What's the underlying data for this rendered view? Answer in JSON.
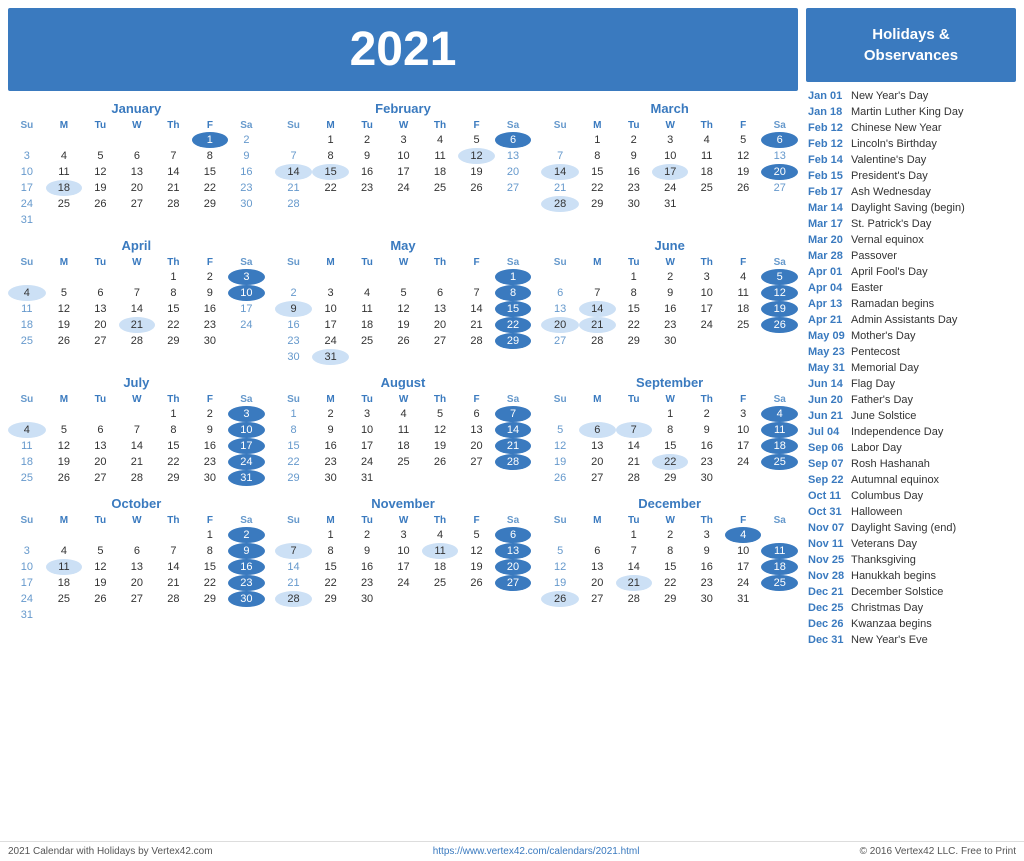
{
  "header": {
    "year": "2021",
    "sidebar_title": "Holidays &\nObservances"
  },
  "months": [
    {
      "name": "January",
      "days_of_week": [
        "Su",
        "M",
        "Tu",
        "W",
        "Th",
        "F",
        "Sa"
      ],
      "weeks": [
        [
          "",
          "",
          "",
          "",
          "",
          "1",
          "2"
        ],
        [
          "3",
          "4",
          "5",
          "6",
          "7",
          "8",
          "9"
        ],
        [
          "10",
          "11",
          "12",
          "13",
          "14",
          "15",
          "16"
        ],
        [
          "17",
          "18",
          "19",
          "20",
          "21",
          "22",
          "23"
        ],
        [
          "24",
          "25",
          "26",
          "27",
          "28",
          "29",
          "30"
        ],
        [
          "31",
          "",
          "",
          "",
          "",
          "",
          ""
        ]
      ],
      "highlights": [
        "1"
      ],
      "light_highlights": [
        "18"
      ]
    },
    {
      "name": "February",
      "days_of_week": [
        "Su",
        "M",
        "Tu",
        "W",
        "Th",
        "F",
        "Sa"
      ],
      "weeks": [
        [
          "",
          "1",
          "2",
          "3",
          "4",
          "5",
          "6"
        ],
        [
          "7",
          "8",
          "9",
          "10",
          "11",
          "12",
          "13"
        ],
        [
          "14",
          "15",
          "16",
          "17",
          "18",
          "19",
          "20"
        ],
        [
          "21",
          "22",
          "23",
          "24",
          "25",
          "26",
          "27"
        ],
        [
          "28",
          "",
          "",
          "",
          "",
          "",
          ""
        ]
      ],
      "highlights": [
        "6"
      ],
      "light_highlights": [
        "14",
        "15",
        "12"
      ]
    },
    {
      "name": "March",
      "days_of_week": [
        "Su",
        "M",
        "Tu",
        "W",
        "Th",
        "F",
        "Sa"
      ],
      "weeks": [
        [
          "",
          "1",
          "2",
          "3",
          "4",
          "5",
          "6"
        ],
        [
          "7",
          "8",
          "9",
          "10",
          "11",
          "12",
          "13"
        ],
        [
          "14",
          "15",
          "16",
          "17",
          "18",
          "19",
          "20"
        ],
        [
          "21",
          "22",
          "23",
          "24",
          "25",
          "26",
          "27"
        ],
        [
          "28",
          "29",
          "30",
          "31",
          "",
          "",
          ""
        ]
      ],
      "highlights": [
        "6",
        "20"
      ],
      "light_highlights": [
        "14",
        "17",
        "28"
      ]
    },
    {
      "name": "April",
      "days_of_week": [
        "Su",
        "M",
        "Tu",
        "W",
        "Th",
        "F",
        "Sa"
      ],
      "weeks": [
        [
          "",
          "",
          "",
          "",
          "1",
          "2",
          "3"
        ],
        [
          "4",
          "5",
          "6",
          "7",
          "8",
          "9",
          "10"
        ],
        [
          "11",
          "12",
          "13",
          "14",
          "15",
          "16",
          "17"
        ],
        [
          "18",
          "19",
          "20",
          "21",
          "22",
          "23",
          "24"
        ],
        [
          "25",
          "26",
          "27",
          "28",
          "29",
          "30",
          ""
        ]
      ],
      "highlights": [
        "3",
        "10"
      ],
      "light_highlights": [
        "4",
        "21"
      ]
    },
    {
      "name": "May",
      "days_of_week": [
        "Su",
        "M",
        "Tu",
        "W",
        "Th",
        "F",
        "Sa"
      ],
      "weeks": [
        [
          "",
          "",
          "",
          "",
          "",
          "",
          "1"
        ],
        [
          "2",
          "3",
          "4",
          "5",
          "6",
          "7",
          "8"
        ],
        [
          "9",
          "10",
          "11",
          "12",
          "13",
          "14",
          "15"
        ],
        [
          "16",
          "17",
          "18",
          "19",
          "20",
          "21",
          "22"
        ],
        [
          "23",
          "24",
          "25",
          "26",
          "27",
          "28",
          "29"
        ],
        [
          "30",
          "31",
          "",
          "",
          "",
          "",
          ""
        ]
      ],
      "highlights": [
        "1",
        "8",
        "15",
        "22",
        "29"
      ],
      "light_highlights": [
        "9",
        "31"
      ]
    },
    {
      "name": "June",
      "days_of_week": [
        "Su",
        "M",
        "Tu",
        "W",
        "Th",
        "F",
        "Sa"
      ],
      "weeks": [
        [
          "",
          "",
          "1",
          "2",
          "3",
          "4",
          "5"
        ],
        [
          "6",
          "7",
          "8",
          "9",
          "10",
          "11",
          "12"
        ],
        [
          "13",
          "14",
          "15",
          "16",
          "17",
          "18",
          "19"
        ],
        [
          "20",
          "21",
          "22",
          "23",
          "24",
          "25",
          "26"
        ],
        [
          "27",
          "28",
          "29",
          "30",
          "",
          "",
          ""
        ]
      ],
      "highlights": [
        "5",
        "12",
        "19",
        "26"
      ],
      "light_highlights": [
        "14",
        "20",
        "21"
      ]
    },
    {
      "name": "July",
      "days_of_week": [
        "Su",
        "M",
        "Tu",
        "W",
        "Th",
        "F",
        "Sa"
      ],
      "weeks": [
        [
          "",
          "",
          "",
          "",
          "1",
          "2",
          "3"
        ],
        [
          "4",
          "5",
          "6",
          "7",
          "8",
          "9",
          "10"
        ],
        [
          "11",
          "12",
          "13",
          "14",
          "15",
          "16",
          "17"
        ],
        [
          "18",
          "19",
          "20",
          "21",
          "22",
          "23",
          "24"
        ],
        [
          "25",
          "26",
          "27",
          "28",
          "29",
          "30",
          "31"
        ]
      ],
      "highlights": [
        "3",
        "10",
        "17",
        "24",
        "31"
      ],
      "light_highlights": [
        "4"
      ]
    },
    {
      "name": "August",
      "days_of_week": [
        "Su",
        "M",
        "Tu",
        "W",
        "Th",
        "F",
        "Sa"
      ],
      "weeks": [
        [
          "1",
          "2",
          "3",
          "4",
          "5",
          "6",
          "7"
        ],
        [
          "8",
          "9",
          "10",
          "11",
          "12",
          "13",
          "14"
        ],
        [
          "15",
          "16",
          "17",
          "18",
          "19",
          "20",
          "21"
        ],
        [
          "22",
          "23",
          "24",
          "25",
          "26",
          "27",
          "28"
        ],
        [
          "29",
          "30",
          "31",
          "",
          "",
          "",
          ""
        ]
      ],
      "highlights": [
        "7",
        "14",
        "21",
        "28"
      ],
      "light_highlights": []
    },
    {
      "name": "September",
      "days_of_week": [
        "Su",
        "M",
        "Tu",
        "W",
        "Th",
        "F",
        "Sa"
      ],
      "weeks": [
        [
          "",
          "",
          "",
          "1",
          "2",
          "3",
          "4"
        ],
        [
          "5",
          "6",
          "7",
          "8",
          "9",
          "10",
          "11"
        ],
        [
          "12",
          "13",
          "14",
          "15",
          "16",
          "17",
          "18"
        ],
        [
          "19",
          "20",
          "21",
          "22",
          "23",
          "24",
          "25"
        ],
        [
          "26",
          "27",
          "28",
          "29",
          "30",
          "",
          ""
        ]
      ],
      "highlights": [
        "4",
        "11",
        "18",
        "25"
      ],
      "light_highlights": [
        "6",
        "7",
        "22"
      ]
    },
    {
      "name": "October",
      "days_of_week": [
        "Su",
        "M",
        "Tu",
        "W",
        "Th",
        "F",
        "Sa"
      ],
      "weeks": [
        [
          "",
          "",
          "",
          "",
          "",
          "1",
          "2"
        ],
        [
          "3",
          "4",
          "5",
          "6",
          "7",
          "8",
          "9"
        ],
        [
          "10",
          "11",
          "12",
          "13",
          "14",
          "15",
          "16"
        ],
        [
          "17",
          "18",
          "19",
          "20",
          "21",
          "22",
          "23"
        ],
        [
          "24",
          "25",
          "26",
          "27",
          "28",
          "29",
          "30"
        ],
        [
          "31",
          "",
          "",
          "",
          "",
          "",
          ""
        ]
      ],
      "highlights": [
        "2",
        "9",
        "16",
        "23",
        "30"
      ],
      "light_highlights": [
        "11"
      ]
    },
    {
      "name": "November",
      "days_of_week": [
        "Su",
        "M",
        "Tu",
        "W",
        "Th",
        "F",
        "Sa"
      ],
      "weeks": [
        [
          "",
          "1",
          "2",
          "3",
          "4",
          "5",
          "6"
        ],
        [
          "7",
          "8",
          "9",
          "10",
          "11",
          "12",
          "13"
        ],
        [
          "14",
          "15",
          "16",
          "17",
          "18",
          "19",
          "20"
        ],
        [
          "21",
          "22",
          "23",
          "24",
          "25",
          "26",
          "27"
        ],
        [
          "28",
          "29",
          "30",
          "",
          "",
          "",
          ""
        ]
      ],
      "highlights": [
        "6",
        "13",
        "20",
        "27"
      ],
      "light_highlights": [
        "7",
        "11",
        "28"
      ]
    },
    {
      "name": "December",
      "days_of_week": [
        "Su",
        "M",
        "Tu",
        "W",
        "Th",
        "F",
        "Sa"
      ],
      "weeks": [
        [
          "",
          "",
          "1",
          "2",
          "3",
          "4",
          ""
        ],
        [
          "5",
          "6",
          "7",
          "8",
          "9",
          "10",
          "11"
        ],
        [
          "12",
          "13",
          "14",
          "15",
          "16",
          "17",
          "18"
        ],
        [
          "19",
          "20",
          "21",
          "22",
          "23",
          "24",
          "25"
        ],
        [
          "26",
          "27",
          "28",
          "29",
          "30",
          "31",
          ""
        ]
      ],
      "highlights": [
        "4",
        "11",
        "18",
        "25"
      ],
      "light_highlights": [
        "21",
        "25",
        "26"
      ]
    }
  ],
  "holidays": [
    {
      "date": "Jan 01",
      "name": "New Year's Day"
    },
    {
      "date": "Jan 18",
      "name": "Martin Luther King Day"
    },
    {
      "date": "Feb 12",
      "name": "Chinese New Year"
    },
    {
      "date": "Feb 12",
      "name": "Lincoln's Birthday"
    },
    {
      "date": "Feb 14",
      "name": "Valentine's Day"
    },
    {
      "date": "Feb 15",
      "name": "President's Day"
    },
    {
      "date": "Feb 17",
      "name": "Ash Wednesday"
    },
    {
      "date": "Mar 14",
      "name": "Daylight Saving (begin)"
    },
    {
      "date": "Mar 17",
      "name": "St. Patrick's Day"
    },
    {
      "date": "Mar 20",
      "name": "Vernal equinox"
    },
    {
      "date": "Mar 28",
      "name": "Passover"
    },
    {
      "date": "Apr 01",
      "name": "April Fool's Day"
    },
    {
      "date": "Apr 04",
      "name": "Easter"
    },
    {
      "date": "Apr 13",
      "name": "Ramadan begins"
    },
    {
      "date": "Apr 21",
      "name": "Admin Assistants Day"
    },
    {
      "date": "May 09",
      "name": "Mother's Day"
    },
    {
      "date": "May 23",
      "name": "Pentecost"
    },
    {
      "date": "May 31",
      "name": "Memorial Day"
    },
    {
      "date": "Jun 14",
      "name": "Flag Day"
    },
    {
      "date": "Jun 20",
      "name": "Father's Day"
    },
    {
      "date": "Jun 21",
      "name": "June Solstice"
    },
    {
      "date": "Jul 04",
      "name": "Independence Day"
    },
    {
      "date": "Sep 06",
      "name": "Labor Day"
    },
    {
      "date": "Sep 07",
      "name": "Rosh Hashanah"
    },
    {
      "date": "Sep 22",
      "name": "Autumnal equinox"
    },
    {
      "date": "Oct 11",
      "name": "Columbus Day"
    },
    {
      "date": "Oct 31",
      "name": "Halloween"
    },
    {
      "date": "Nov 07",
      "name": "Daylight Saving (end)"
    },
    {
      "date": "Nov 11",
      "name": "Veterans Day"
    },
    {
      "date": "Nov 25",
      "name": "Thanksgiving"
    },
    {
      "date": "Nov 28",
      "name": "Hanukkah begins"
    },
    {
      "date": "Dec 21",
      "name": "December Solstice"
    },
    {
      "date": "Dec 25",
      "name": "Christmas Day"
    },
    {
      "date": "Dec 26",
      "name": "Kwanzaa begins"
    },
    {
      "date": "Dec 31",
      "name": "New Year's Eve"
    }
  ],
  "footer": {
    "left": "2021 Calendar with Holidays by Vertex42.com",
    "center": "https://www.vertex42.com/calendars/2021.html",
    "right": "© 2016 Vertex42 LLC. Free to Print"
  }
}
